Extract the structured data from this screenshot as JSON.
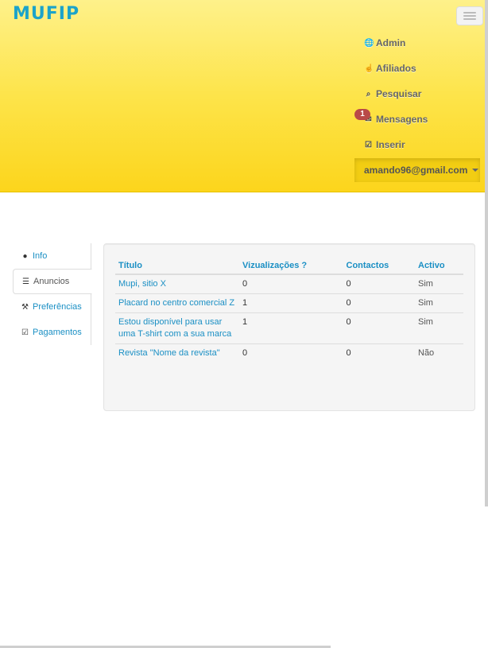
{
  "brand": {
    "logo_text": "MUFIP"
  },
  "navbar": {
    "items": [
      {
        "label": "Admin",
        "icon": "globe-icon"
      },
      {
        "label": "Afiliados",
        "icon": "thumbs-up-icon"
      },
      {
        "label": "Pesquisar",
        "icon": "search-icon"
      },
      {
        "label": "Mensagens",
        "icon": "envelope-icon",
        "badge": "1"
      },
      {
        "label": "Inserir",
        "icon": "edit-icon"
      }
    ],
    "user_email": "amando96@gmail.com"
  },
  "sidebar": {
    "items": [
      {
        "label": "Info",
        "icon": "user-icon"
      },
      {
        "label": "Anuncios",
        "icon": "list-icon",
        "active": true
      },
      {
        "label": "Preferências",
        "icon": "wrench-icon"
      },
      {
        "label": "Pagamentos",
        "icon": "check-square-icon"
      }
    ]
  },
  "table": {
    "headers": [
      "Título",
      "Vizualizações ?",
      "Contactos",
      "Activo"
    ],
    "rows": [
      {
        "title": "Mupi, sitio X",
        "views": "0",
        "contacts": "0",
        "active": "Sim"
      },
      {
        "title": "Placard no centro comercial Z",
        "views": "1",
        "contacts": "0",
        "active": "Sim"
      },
      {
        "title": "Estou disponível para usar uma T-shirt com a sua marca",
        "views": "1",
        "contacts": "0",
        "active": "Sim"
      },
      {
        "title": "Revista \"Nome da revista\"",
        "views": "0",
        "contacts": "0",
        "active": "Não"
      }
    ]
  },
  "colors": {
    "accent": "#1a8fc4",
    "navbar_yellow": "#fde44a",
    "badge": "#b94a48"
  }
}
